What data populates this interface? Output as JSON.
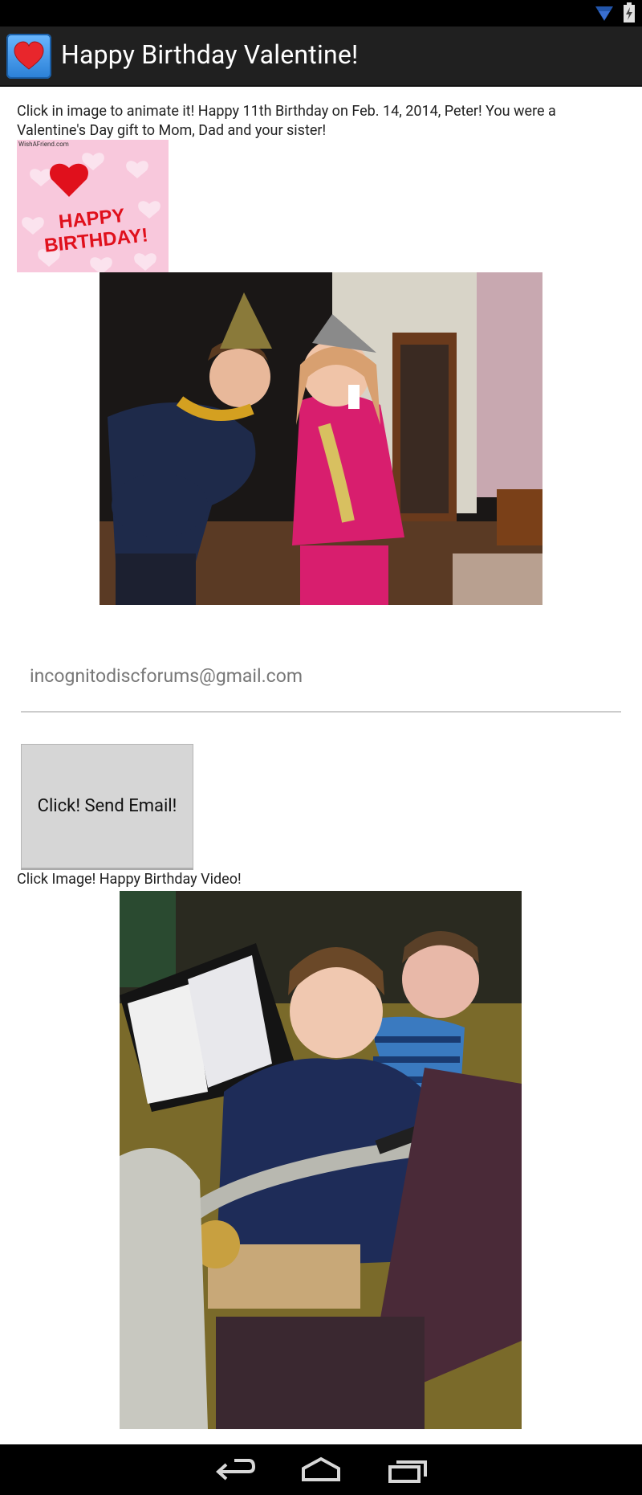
{
  "app": {
    "title": "Happy Birthday Valentine!",
    "icon": "heart-icon",
    "accent": "#2a7fd6"
  },
  "main": {
    "intro_text": "Click in image to animate it! Happy 11th Birthday on Feb. 14, 2014, Peter! You were a Valentine's Day gift to Mom, Dad and your sister!",
    "card": {
      "watermark": "WishAFriend.com",
      "line1": "HAPPY",
      "line2": "BIRTHDAY!"
    },
    "email_field": {
      "value": "incognitodiscforums@gmail.com"
    },
    "send_button_label": "Click! Send Email!",
    "video_label": "Click Image! Happy Birthday Video!"
  },
  "nav": {
    "buttons": [
      "back-icon",
      "home-icon",
      "recent-apps-icon"
    ]
  }
}
